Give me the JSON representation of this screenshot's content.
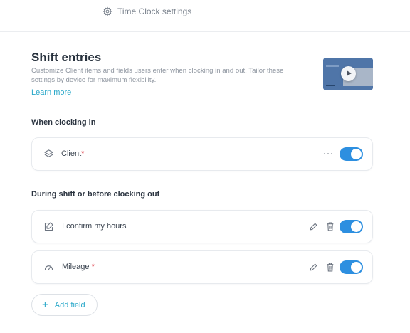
{
  "header": {
    "settings_label": "Time Clock settings"
  },
  "intro": {
    "title": "Shift entries",
    "description": "Customize Client items and fields users enter when clocking in and out. Tailor these settings by device for maximum flexibility.",
    "learn_more": "Learn more"
  },
  "clock_in": {
    "heading": "When clocking in",
    "fields": [
      {
        "label": "Client",
        "required_mark": "*",
        "icon": "layers-icon",
        "enabled": true
      }
    ]
  },
  "during_shift": {
    "heading": "During shift or before clocking out",
    "fields": [
      {
        "label": "I confirm my hours",
        "required_mark": "",
        "icon": "edit-note-icon",
        "enabled": true
      },
      {
        "label": "Mileage",
        "required_mark": "*",
        "icon": "gauge-icon",
        "enabled": true
      }
    ]
  },
  "add_field": {
    "label": "Add field",
    "icon": "plus-icon"
  },
  "colors": {
    "accent": "#2aa8c9",
    "toggle_on": "#2d8fe0",
    "required": "#e0454f"
  }
}
